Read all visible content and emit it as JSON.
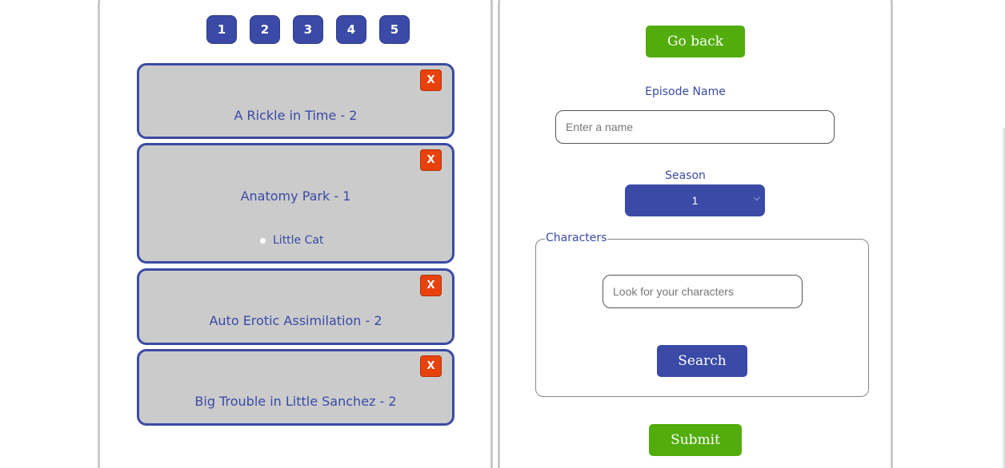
{
  "pagination": {
    "pages": [
      "1",
      "2",
      "3",
      "4",
      "5"
    ]
  },
  "episodes": [
    {
      "title": "A Rickle in Time - 2",
      "delete_label": "X",
      "characters": []
    },
    {
      "title": "Anatomy Park - 1",
      "delete_label": "X",
      "characters": [
        "Little Cat"
      ]
    },
    {
      "title": "Auto Erotic Assimilation - 2",
      "delete_label": "X",
      "characters": []
    },
    {
      "title": "Big Trouble in Little Sanchez - 2",
      "delete_label": "X",
      "characters": []
    }
  ],
  "form": {
    "go_back_label": "Go back",
    "episode_name_label": "Episode Name",
    "episode_name_placeholder": "Enter a name",
    "season_label": "Season",
    "season_value": "1",
    "characters_legend": "Characters",
    "character_search_placeholder": "Look for your characters",
    "search_label": "Search",
    "submit_label": "Submit"
  },
  "colors": {
    "primary": "#3a4aa6",
    "success": "#52ad0c",
    "danger": "#e8420c",
    "card_bg": "#cbcbcb"
  },
  "icons": {
    "season_dropdown": "chevron-down-icon"
  }
}
